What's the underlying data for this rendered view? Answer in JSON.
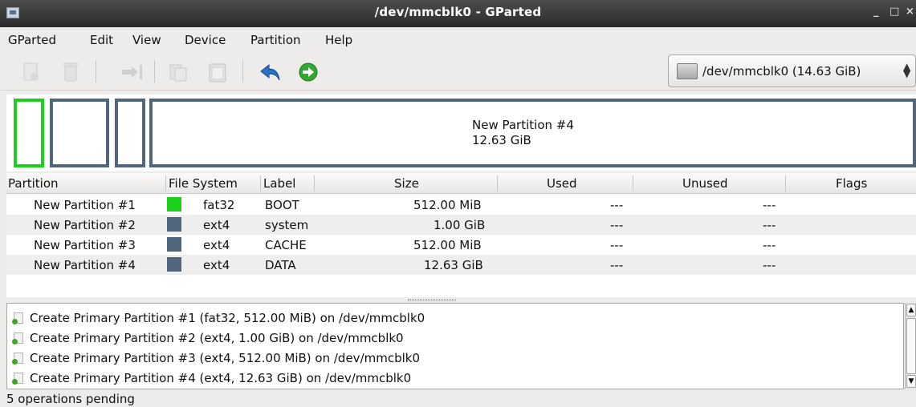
{
  "window": {
    "title": "/dev/mmcblk0 - GParted",
    "minimize_glyph": "_",
    "maximize_glyph": "□",
    "close_glyph": "×"
  },
  "menu": [
    "GParted",
    "Edit",
    "View",
    "Device",
    "Partition",
    "Help"
  ],
  "toolbar": {
    "buttons": [
      "new-partition",
      "delete-partition",
      "resize-move",
      "copy",
      "paste",
      "undo",
      "apply"
    ],
    "device_select": "/dev/mmcblk0  (14.63 GiB)"
  },
  "partition_map": {
    "selected": "New Partition #1",
    "large_label_name": "New Partition #4",
    "large_label_size": "12.63 GiB"
  },
  "table": {
    "columns": [
      "Partition",
      "File System",
      "Label",
      "Size",
      "Used",
      "Unused",
      "Flags"
    ],
    "rows": [
      {
        "partition": "New Partition #1",
        "fs": "fat32",
        "fs_color": "#1ed01e",
        "label": "BOOT",
        "size": "512.00 MiB",
        "used": "---",
        "unused": "---",
        "flags": ""
      },
      {
        "partition": "New Partition #2",
        "fs": "ext4",
        "fs_color": "#4f667d",
        "label": "system",
        "size": "1.00 GiB",
        "used": "---",
        "unused": "---",
        "flags": ""
      },
      {
        "partition": "New Partition #3",
        "fs": "ext4",
        "fs_color": "#4f667d",
        "label": "CACHE",
        "size": "512.00 MiB",
        "used": "---",
        "unused": "---",
        "flags": ""
      },
      {
        "partition": "New Partition #4",
        "fs": "ext4",
        "fs_color": "#4f667d",
        "label": "DATA",
        "size": "12.63 GiB",
        "used": "---",
        "unused": "---",
        "flags": ""
      }
    ]
  },
  "operations": [
    "Create Primary Partition #1 (fat32, 512.00 MiB) on /dev/mmcblk0",
    "Create Primary Partition #2 (ext4, 1.00 GiB) on /dev/mmcblk0",
    "Create Primary Partition #3 (ext4, 512.00 MiB) on /dev/mmcblk0",
    "Create Primary Partition #4 (ext4, 12.63 GiB) on /dev/mmcblk0"
  ],
  "status": "5 operations pending",
  "colors": {
    "fat32": "#1ed01e",
    "ext4": "#4f667d",
    "apply_green": "#32a832",
    "undo_blue": "#2a6fc4"
  }
}
